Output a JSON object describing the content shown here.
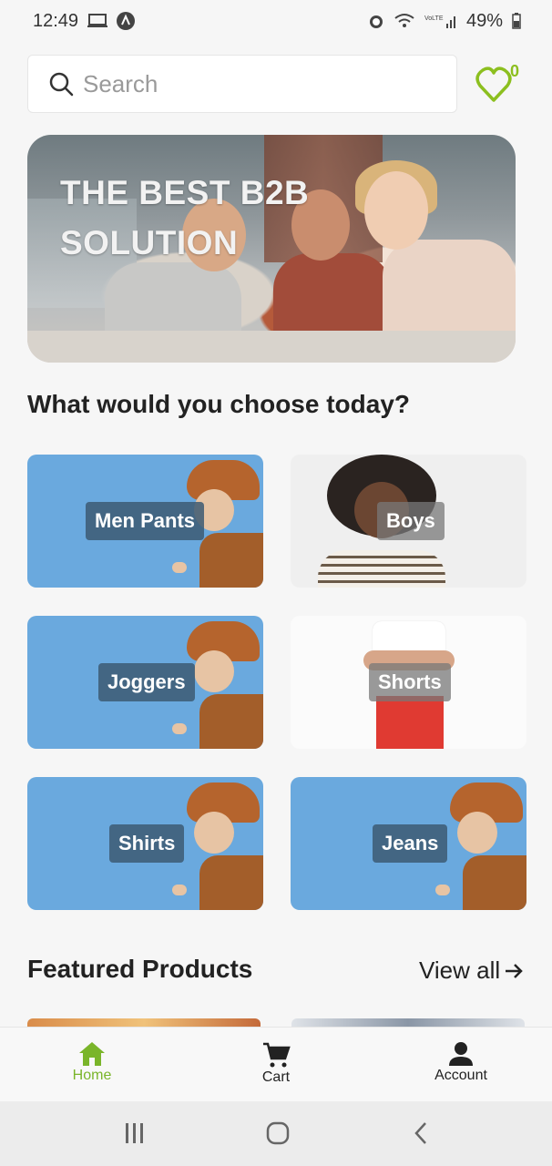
{
  "status_bar": {
    "time": "12:49",
    "battery": "49%"
  },
  "search": {
    "placeholder": "Search"
  },
  "wishlist": {
    "count": "0"
  },
  "banner": {
    "title": "THE BEST B2B SOLUTION"
  },
  "categories_section": {
    "title": "What would you choose today?",
    "items": [
      {
        "label": "Men Pants"
      },
      {
        "label": "Boys"
      },
      {
        "label": "Joggers"
      },
      {
        "label": "Shorts"
      },
      {
        "label": "Shirts"
      },
      {
        "label": "Jeans"
      }
    ]
  },
  "featured": {
    "title": "Featured Products",
    "view_all": "View all"
  },
  "bottom_nav": {
    "items": [
      {
        "label": "Home",
        "icon": "home-icon",
        "active": true
      },
      {
        "label": "Cart",
        "icon": "cart-icon",
        "active": false
      },
      {
        "label": "Account",
        "icon": "account-icon",
        "active": false
      }
    ]
  },
  "colors": {
    "accent": "#7ab52a",
    "card_blue": "#6aa9de"
  }
}
